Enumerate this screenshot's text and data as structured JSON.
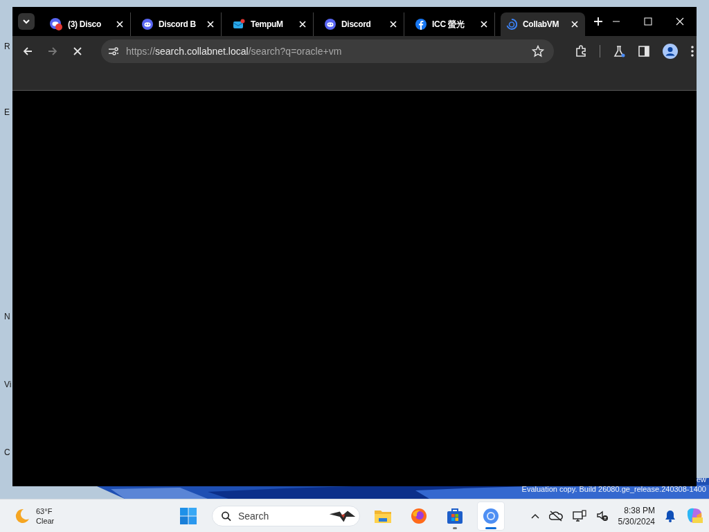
{
  "desktop": {
    "icon_labels": [
      "R",
      "E",
      "N",
      "Vi",
      "C"
    ],
    "watermark_lines": [
      "ew",
      "Evaluation copy. Build 26080.ge_release.240308-1400"
    ]
  },
  "browser": {
    "tabs": [
      {
        "title": "(3) Disco",
        "kind": "discord-badge",
        "selected": false
      },
      {
        "title": "Discord B",
        "kind": "discord",
        "selected": false
      },
      {
        "title": "TempuM",
        "kind": "mail",
        "selected": false
      },
      {
        "title": "Discord",
        "kind": "discord",
        "selected": false
      },
      {
        "title": "ICC 螢光",
        "kind": "facebook",
        "selected": false
      },
      {
        "title": "CollabVM",
        "kind": "collabvm",
        "selected": true
      }
    ],
    "loading": true,
    "url": {
      "scheme": "https://",
      "host": "search.collabnet.local",
      "path": "/search?q=oracle+vm"
    }
  },
  "taskbar": {
    "weather": {
      "temperature": "63°F",
      "condition": "Clear"
    },
    "search": {
      "placeholder": "Search"
    },
    "apps": [
      {
        "kind": "folder",
        "running": false,
        "selected": false
      },
      {
        "kind": "firefox",
        "running": false,
        "selected": false
      },
      {
        "kind": "store",
        "running": true,
        "selected": false
      },
      {
        "kind": "chrome",
        "running": true,
        "selected": true
      }
    ],
    "time": "8:38 PM",
    "date": "5/30/2024"
  }
}
